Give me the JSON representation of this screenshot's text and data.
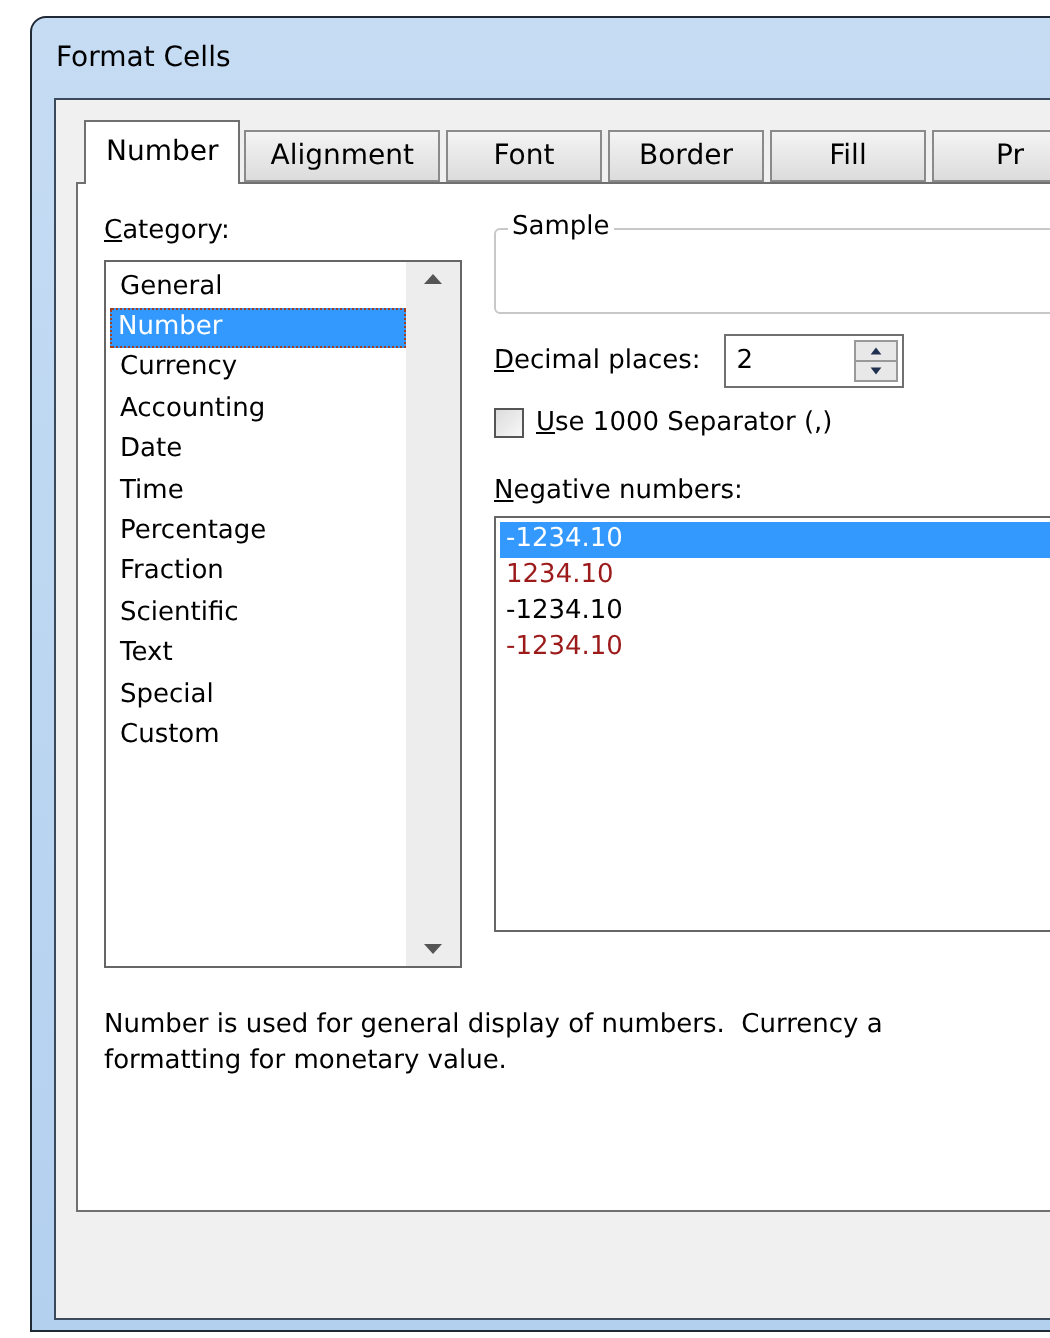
{
  "window": {
    "title": "Format Cells"
  },
  "tabs": [
    {
      "label": "Number",
      "selected": true
    },
    {
      "label": "Alignment",
      "selected": false
    },
    {
      "label": "Font",
      "selected": false
    },
    {
      "label": "Border",
      "selected": false
    },
    {
      "label": "Fill",
      "selected": false
    },
    {
      "label": "Pr",
      "selected": false
    }
  ],
  "category": {
    "label": {
      "underlined": "C",
      "rest": "ategory:"
    },
    "items": [
      {
        "label": "General",
        "selected": false
      },
      {
        "label": "Number",
        "selected": true
      },
      {
        "label": "Currency",
        "selected": false
      },
      {
        "label": "Accounting",
        "selected": false
      },
      {
        "label": "Date",
        "selected": false
      },
      {
        "label": "Time",
        "selected": false
      },
      {
        "label": "Percentage",
        "selected": false
      },
      {
        "label": "Fraction",
        "selected": false
      },
      {
        "label": "Scientific",
        "selected": false
      },
      {
        "label": "Text",
        "selected": false
      },
      {
        "label": "Special",
        "selected": false
      },
      {
        "label": "Custom",
        "selected": false
      }
    ]
  },
  "sample": {
    "label": "Sample"
  },
  "decimal_places": {
    "label": {
      "underlined": "D",
      "rest": "ecimal places:"
    },
    "value": "2"
  },
  "separator": {
    "label": {
      "underlined": "U",
      "rest": "se 1000 Separator (,)"
    },
    "checked": false
  },
  "negative_numbers": {
    "label": {
      "underlined": "N",
      "rest": "egative numbers:"
    },
    "items": [
      {
        "label": "-1234.10",
        "selected": true
      },
      {
        "label": "1234.10",
        "selected": false,
        "color": "#9c1a1a"
      },
      {
        "label": "-1234.10",
        "selected": false,
        "color": "#000000"
      },
      {
        "label": "-1234.10",
        "selected": false,
        "color": "#9c1a1a"
      }
    ]
  },
  "description": [
    "Number is used for general display of numbers.  Currency a",
    "formatting for monetary value."
  ]
}
